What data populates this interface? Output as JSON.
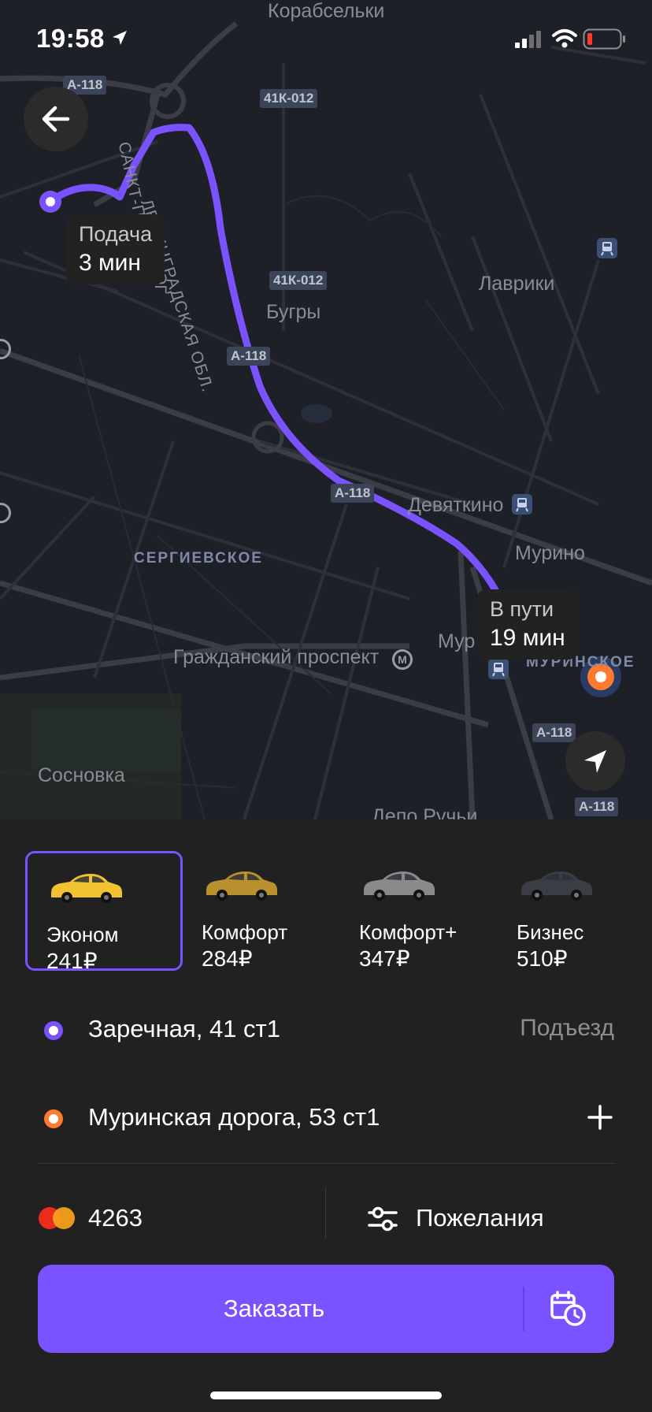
{
  "status_bar": {
    "time": "19:58"
  },
  "map": {
    "pickup_bubble": {
      "title": "Подача",
      "eta": "3 мин"
    },
    "route_bubble": {
      "title": "В пути",
      "eta": "19 мин"
    },
    "labels": {
      "korabselki": "Корабсельки",
      "lavriki": "Лаврики",
      "bugry": "Бугры",
      "devyatkino": "Девяткино",
      "murino": "Мурино",
      "murinskoe_partial": "Мур",
      "murinskoe": "МУРИНСКОЕ",
      "sergievskoe": "СЕРГИЕВСКОЕ",
      "grazhdansky": "Гражданский проспект",
      "sosnovka": "Сосновка",
      "depo": "Депо Ручьи",
      "lenobl": "ЛЕНИНГРАДСКАЯ ОБЛ.",
      "spb_partial": "САНКТ-П",
      "spb_tail": "ОГ"
    },
    "road_signs": [
      "А-118",
      "41К-012",
      "41К-012",
      "А-118",
      "А-118",
      "А-118",
      "А-118"
    ]
  },
  "tariffs": [
    {
      "name": "Эконом",
      "price": "241₽",
      "color": "#f2c230",
      "selected": true
    },
    {
      "name": "Комфорт",
      "price": "284₽",
      "color": "#b8902e",
      "selected": false
    },
    {
      "name": "Комфорт+",
      "price": "347₽",
      "color": "#8a8a8a",
      "selected": false
    },
    {
      "name": "Бизнес",
      "price": "510₽",
      "color": "#3a3d44",
      "selected": false
    }
  ],
  "route": {
    "from": {
      "address": "Заречная, 41 ст1",
      "hint": "Подъезд"
    },
    "to": {
      "address": "Муринская дорога, 53 ст1",
      "action": "+"
    }
  },
  "payment": {
    "card_last4": "4263"
  },
  "preferences": {
    "label": "Пожелания"
  },
  "order": {
    "label": "Заказать"
  },
  "colors": {
    "accent": "#7a52ff",
    "destination": "#ff7a2e",
    "sheet_bg": "#212121",
    "map_bg": "#1e2028"
  },
  "icons": [
    "back-arrow-icon",
    "location-arrow-icon",
    "navigation-icon",
    "metro-icon",
    "train-icon",
    "mastercard-icon",
    "sliders-icon",
    "calendar-clock-icon",
    "plus-icon"
  ]
}
